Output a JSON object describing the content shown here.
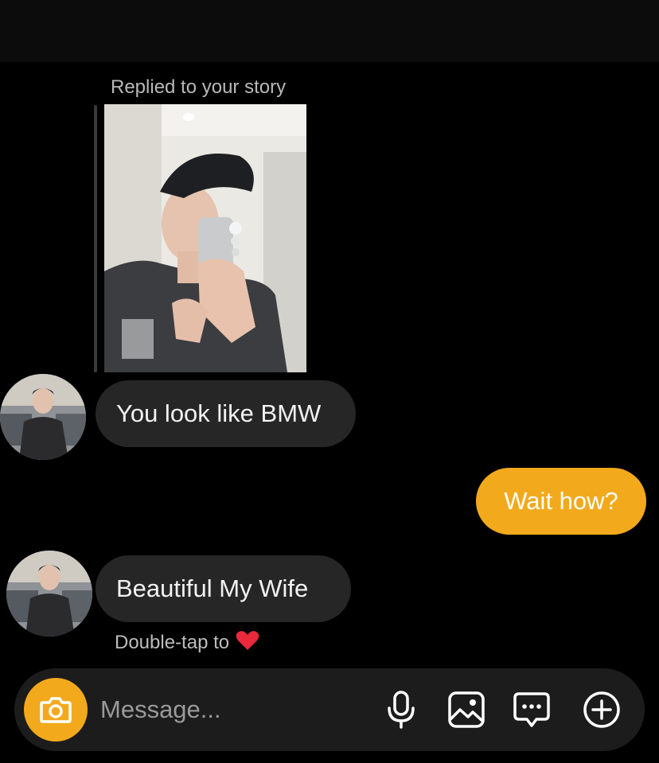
{
  "story_reply": {
    "caption": "Replied to your story"
  },
  "messages": [
    {
      "side": "incoming",
      "text": "You look like BMW"
    },
    {
      "side": "outgoing",
      "text": "Wait how?"
    },
    {
      "side": "incoming",
      "text": "Beautiful My Wife"
    }
  ],
  "hint": {
    "text": "Double-tap to"
  },
  "composer": {
    "placeholder": "Message..."
  },
  "colors": {
    "accent": "#f2a91c",
    "incoming_bubble": "#262626",
    "background": "#000000",
    "heart": "#e8293b"
  },
  "icons": [
    "camera-icon",
    "microphone-icon",
    "image-icon",
    "sticker-chat-icon",
    "plus-circle-icon",
    "heart-icon"
  ]
}
